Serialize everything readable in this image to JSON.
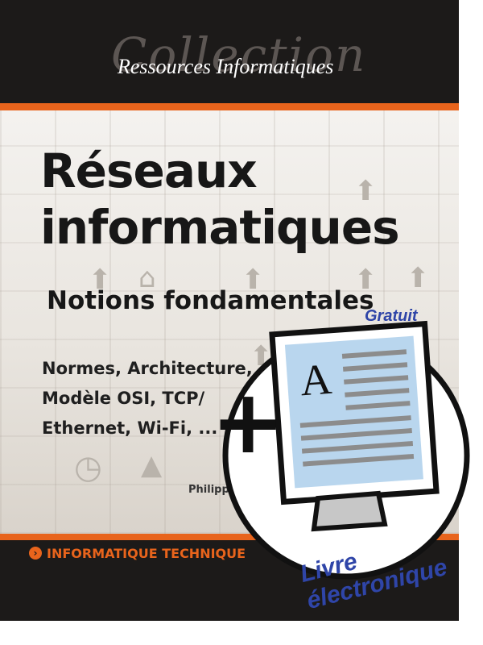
{
  "cover": {
    "collection_word": "Collection",
    "series": "Ressources Informatiques",
    "title_line1": "Réseaux",
    "title_line2": "informatiques",
    "subtitle": "Notions fondamentales",
    "topics": [
      "Normes, Architecture,",
      "Modèle OSI, TCP/",
      "Ethernet, Wi-Fi, ..."
    ],
    "author": "Philippe A",
    "domain": "INFORMATIQUE TECHNIQUE"
  },
  "badge": {
    "top_text": "Gratuit",
    "bottom_text": "Livre électronique",
    "monitor_letter": "A",
    "plus_sign": "+"
  },
  "colors": {
    "accent_orange": "#e8641c",
    "band_dark": "#1c1a19",
    "badge_blue": "#2f45a8",
    "screen_blue": "#b9d6ee"
  },
  "icons": [
    "arrow-right-icon",
    "monitor-icon",
    "plus-icon"
  ]
}
